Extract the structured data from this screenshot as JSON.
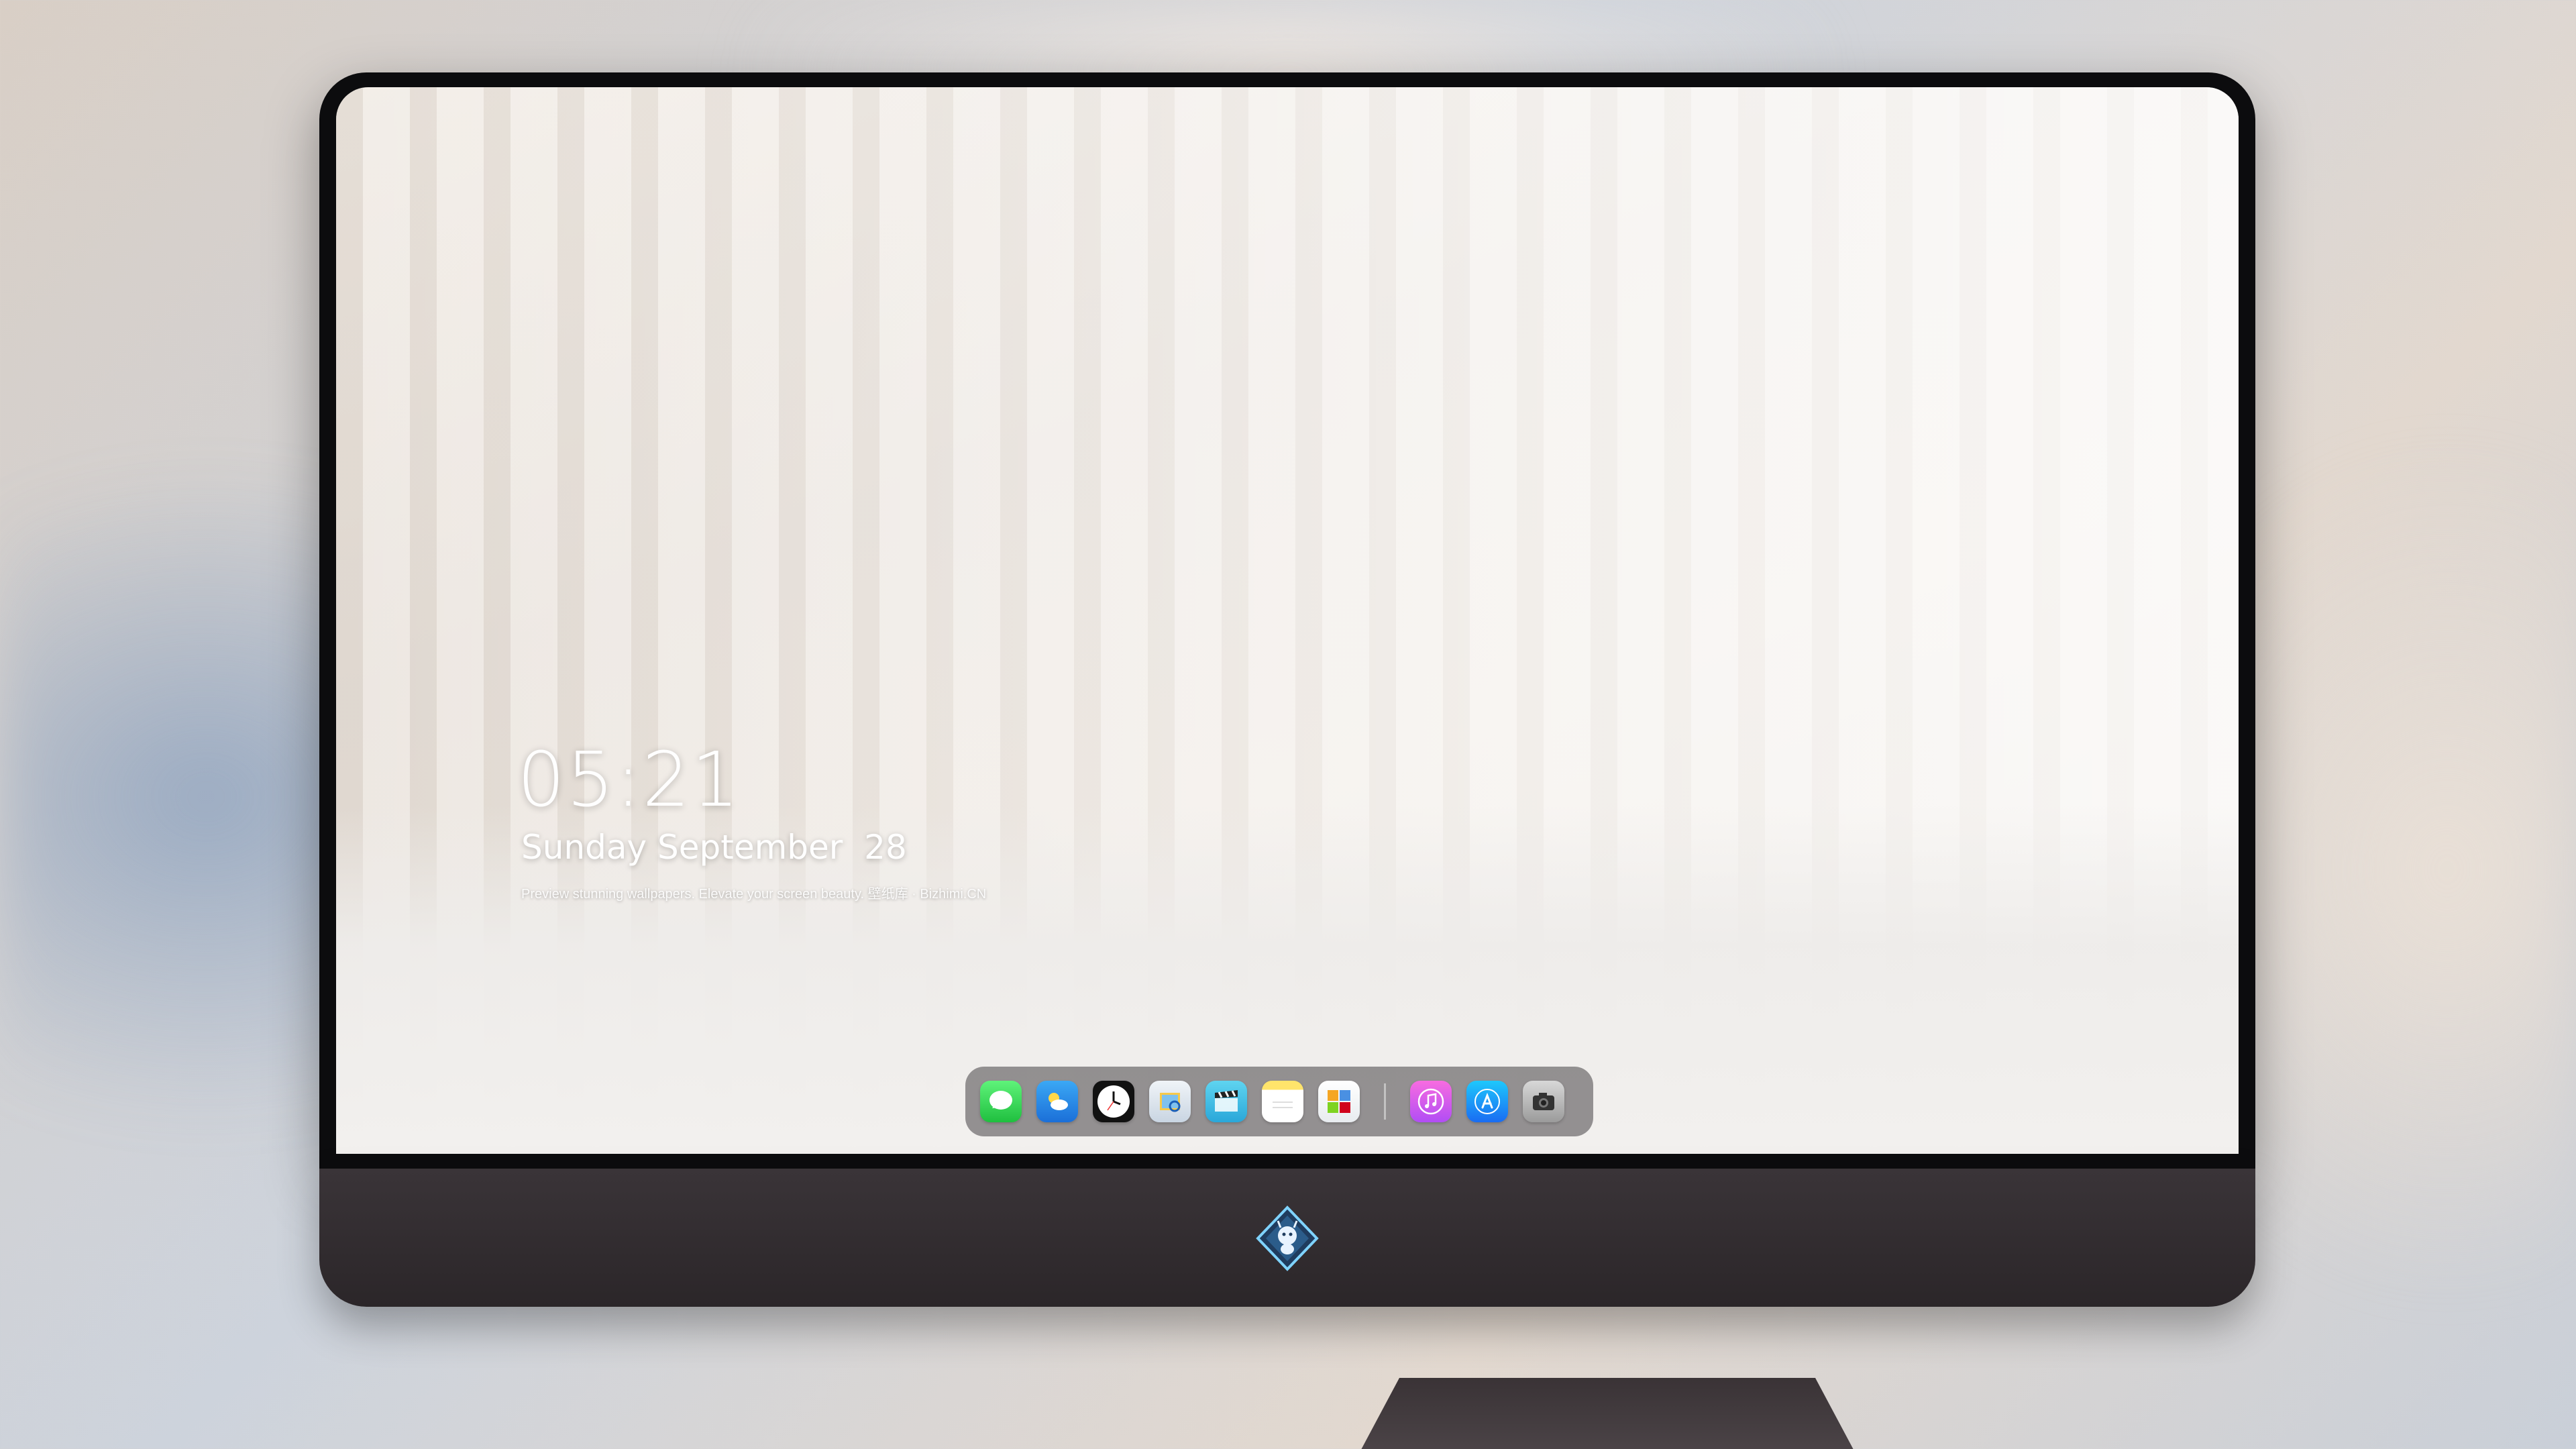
{
  "lock_screen": {
    "time": "05:21",
    "date": "Sunday September  28",
    "caption": "Preview stunning wallpapers. Elevate your screen beauty. 壁纸库 · Bizhimi.CN"
  },
  "dock": {
    "apps": [
      {
        "name": "Messages",
        "icon": "messages-icon"
      },
      {
        "name": "Weather",
        "icon": "weather-icon"
      },
      {
        "name": "Clock",
        "icon": "clock-icon"
      },
      {
        "name": "Preview",
        "icon": "preview-icon"
      },
      {
        "name": "Claquette",
        "icon": "clapperboard-icon"
      },
      {
        "name": "Notes",
        "icon": "notes-icon"
      },
      {
        "name": "Photos",
        "icon": "photos-icon"
      },
      {
        "name": "iTunes",
        "icon": "music-note-icon"
      },
      {
        "name": "App Store",
        "icon": "app-store-icon"
      },
      {
        "name": "Camera",
        "icon": "camera-icon"
      }
    ]
  },
  "monitor": {
    "chin_logo": "dragon-logo-icon"
  },
  "colors": {
    "bezel": "#0c0c0e",
    "chin": "#2b2629",
    "dock_bg": "rgba(70,66,70,0.55)",
    "text": "#ffffff"
  }
}
